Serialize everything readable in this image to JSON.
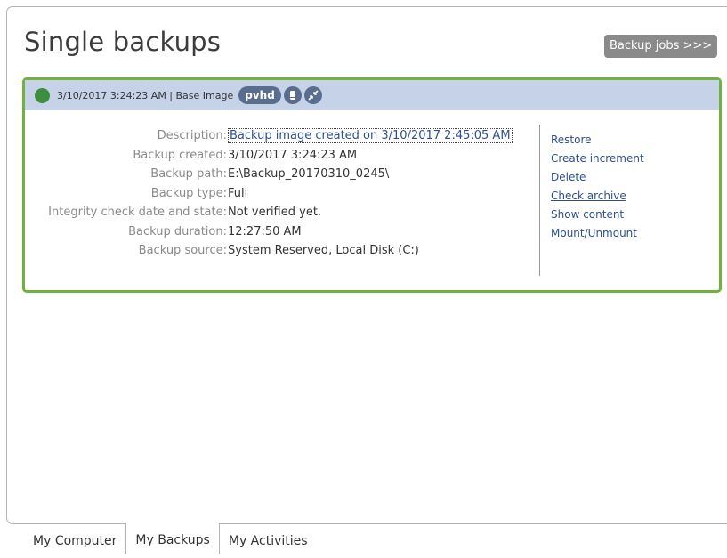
{
  "page": {
    "title": "Single backups",
    "jobs_button": "Backup jobs >>>"
  },
  "backup": {
    "header": "3/10/2017 3:24:23 AM | Base Image",
    "format_badge": "pvhd",
    "status_color": "#3e8d3e",
    "icons": [
      "disk-icon",
      "compress-icon"
    ],
    "details": [
      {
        "label": "Description:",
        "value": "Backup image created on 3/10/2017 2:45:05 AM"
      },
      {
        "label": "Backup created:",
        "value": "3/10/2017 3:24:23 AM"
      },
      {
        "label": "Backup path:",
        "value": "E:\\Backup_20170310_0245\\"
      },
      {
        "label": "Backup type:",
        "value": "Full"
      },
      {
        "label": "Integrity check date and state:",
        "value": "Not verified yet."
      },
      {
        "label": "Backup duration:",
        "value": "12:27:50 AM"
      },
      {
        "label": "Backup source:",
        "value": "System Reserved, Local Disk (C:)"
      }
    ],
    "actions": [
      "Restore",
      "Create increment",
      "Delete",
      "Check archive",
      "Show content",
      "Mount/Unmount"
    ]
  },
  "tabs": [
    {
      "label": "My Computer",
      "active": false
    },
    {
      "label": "My Backups",
      "active": true
    },
    {
      "label": "My Activities",
      "active": false
    }
  ],
  "colors": {
    "accent_border": "#6fb23d",
    "header_bg": "#c6d2e8",
    "link": "#2d4f8f",
    "badge": "#5b6d8f"
  }
}
